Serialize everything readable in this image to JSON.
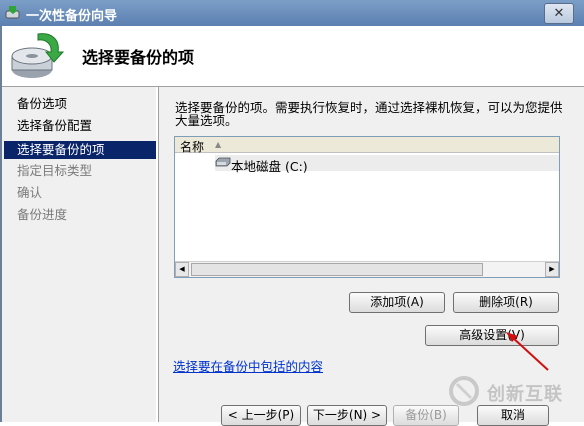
{
  "window": {
    "title": "一次性备份向导",
    "close_glyph": "✕"
  },
  "header": {
    "page_title": "选择要备份的项"
  },
  "nav": {
    "items": [
      {
        "label": "备份选项",
        "state": "done"
      },
      {
        "label": "选择备份配置",
        "state": "done"
      },
      {
        "label": "选择要备份的项",
        "state": "current"
      },
      {
        "label": "指定目标类型",
        "state": "pending"
      },
      {
        "label": "确认",
        "state": "pending"
      },
      {
        "label": "备份进度",
        "state": "pending"
      }
    ]
  },
  "content": {
    "description": "选择要备份的项。需要执行恢复时，通过选择裸机恢复，可以为您提供大量选项。",
    "list": {
      "column_name": "名称",
      "items": [
        {
          "label": "本地磁盘 (C:)",
          "icon": "disk-drive-icon"
        }
      ]
    },
    "add_item_label": "添加项(A)",
    "remove_item_label": "删除项(R)",
    "advanced_label": "高级设置(V)",
    "link_text": "选择要在备份中包括的内容"
  },
  "footer": {
    "prev_label": "< 上一步(P)",
    "next_label": "下一步(N) >",
    "backup_label": "备份(B)",
    "cancel_label": "取消"
  },
  "watermark": {
    "text": "创新互联"
  },
  "colors": {
    "nav_selected": "#0a246a",
    "link": "#0033cc",
    "annotation_arrow": "#d01010"
  }
}
